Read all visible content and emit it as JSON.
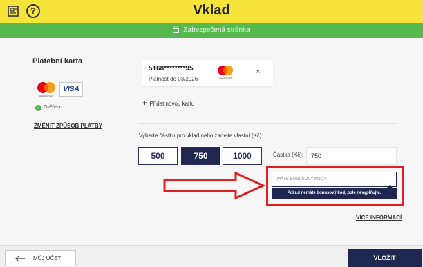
{
  "header": {
    "title": "Vklad",
    "icons": [
      "document-icon",
      "help-icon"
    ],
    "help_glyph": "?",
    "color": "#f6e43b"
  },
  "secure_bar": {
    "text": "Zabezpečená stránka",
    "color": "#56b94d"
  },
  "payment_method": {
    "title": "Platební karta",
    "brands": [
      "mastercard",
      "VISA"
    ],
    "mastercard_text": "mastercard",
    "visa_text": "VISA",
    "verified_text": "Ověřeno",
    "verified_mark": "✓",
    "change_link": "ZMĚNIT ZPŮSOB PLATBY"
  },
  "saved_card": {
    "number": "5168********95",
    "validity": "Platnost do 03/2026",
    "brand_text": "mastercard",
    "remove_glyph": "×"
  },
  "add_card": {
    "plus": "+",
    "label": "Přidat novou kartu"
  },
  "amount": {
    "prompt": "Vyberte částku pro vklad nebo zadejte vlastní (Kč):",
    "options": [
      "500",
      "750",
      "1000"
    ],
    "selected": "750",
    "field_label": "Částka (Kč):",
    "field_value": "750"
  },
  "bonus": {
    "placeholder": "MÁTE BONUSOVÝ KÓD?",
    "tooltip": "Pokud nemáte bonusový kód, pole nevyplňujte.",
    "highlight_color": "#e02020"
  },
  "more_info": "VÍCE INFORMACÍ",
  "footer": {
    "back_label": "MŮJ ÚČET",
    "submit_label": "VLOŽIT",
    "submit_color": "#1f2650"
  }
}
